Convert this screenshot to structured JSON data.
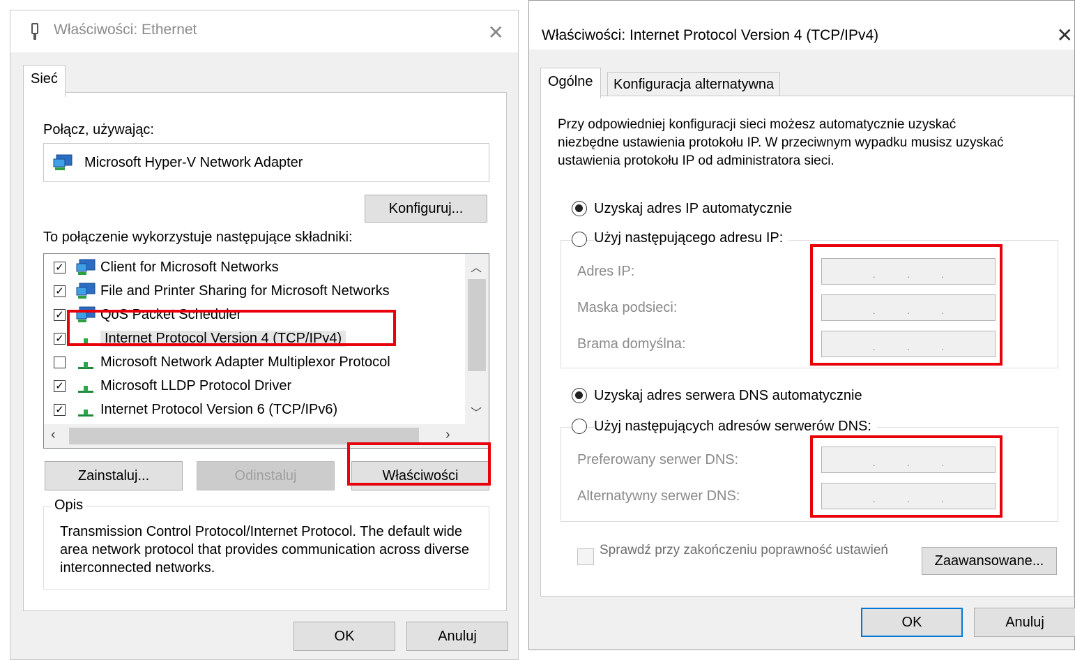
{
  "left": {
    "title": "Właściwości: Ethernet",
    "tab": "Sieć",
    "connect_label": "Połącz, używając:",
    "adapter": "Microsoft Hyper-V Network Adapter",
    "configure": "Konfiguruj...",
    "components_label": "To połączenie wykorzystuje następujące składniki:",
    "items": [
      {
        "label": "Client for Microsoft Networks",
        "checked": true
      },
      {
        "label": "File and Printer Sharing for Microsoft Networks",
        "checked": true
      },
      {
        "label": "QoS Packet Scheduler",
        "checked": true
      },
      {
        "label": "Internet Protocol Version 4 (TCP/IPv4)",
        "checked": true
      },
      {
        "label": "Microsoft Network Adapter Multiplexor Protocol",
        "checked": false
      },
      {
        "label": "Microsoft LLDP Protocol Driver",
        "checked": true
      },
      {
        "label": "Internet Protocol Version 6 (TCP/IPv6)",
        "checked": true
      }
    ],
    "install": "Zainstaluj...",
    "uninstall": "Odinstaluj",
    "properties": "Właściwości",
    "desc_legend": "Opis",
    "desc_text": "Transmission Control Protocol/Internet Protocol. The default wide area network protocol that provides communication across diverse interconnected networks.",
    "ok": "OK",
    "cancel": "Anuluj"
  },
  "right": {
    "title": "Właściwości: Internet Protocol Version 4 (TCP/IPv4)",
    "tabs": [
      "Ogólne",
      "Konfiguracja alternatywna"
    ],
    "intro": "Przy odpowiedniej konfiguracji sieci możesz automatycznie uzyskać niezbędne ustawienia protokołu IP. W przeciwnym wypadku musisz uzyskać ustawienia protokołu IP od administratora sieci.",
    "ip_auto": "Uzyskaj adres IP automatycznie",
    "ip_manual": "Użyj następującego adresu IP:",
    "ip_label": "Adres IP:",
    "mask_label": "Maska podsieci:",
    "gateway_label": "Brama domyślna:",
    "dns_auto": "Uzyskaj adres serwera DNS automatycznie",
    "dns_manual": "Użyj następujących adresów serwerów DNS:",
    "dns_pref": "Preferowany serwer DNS:",
    "dns_alt": "Alternatywny serwer DNS:",
    "validate": "Sprawdź przy zakończeniu poprawność ustawień",
    "advanced": "Zaawansowane...",
    "ok": "OK",
    "cancel": "Anuluj"
  },
  "ip_dots": "."
}
